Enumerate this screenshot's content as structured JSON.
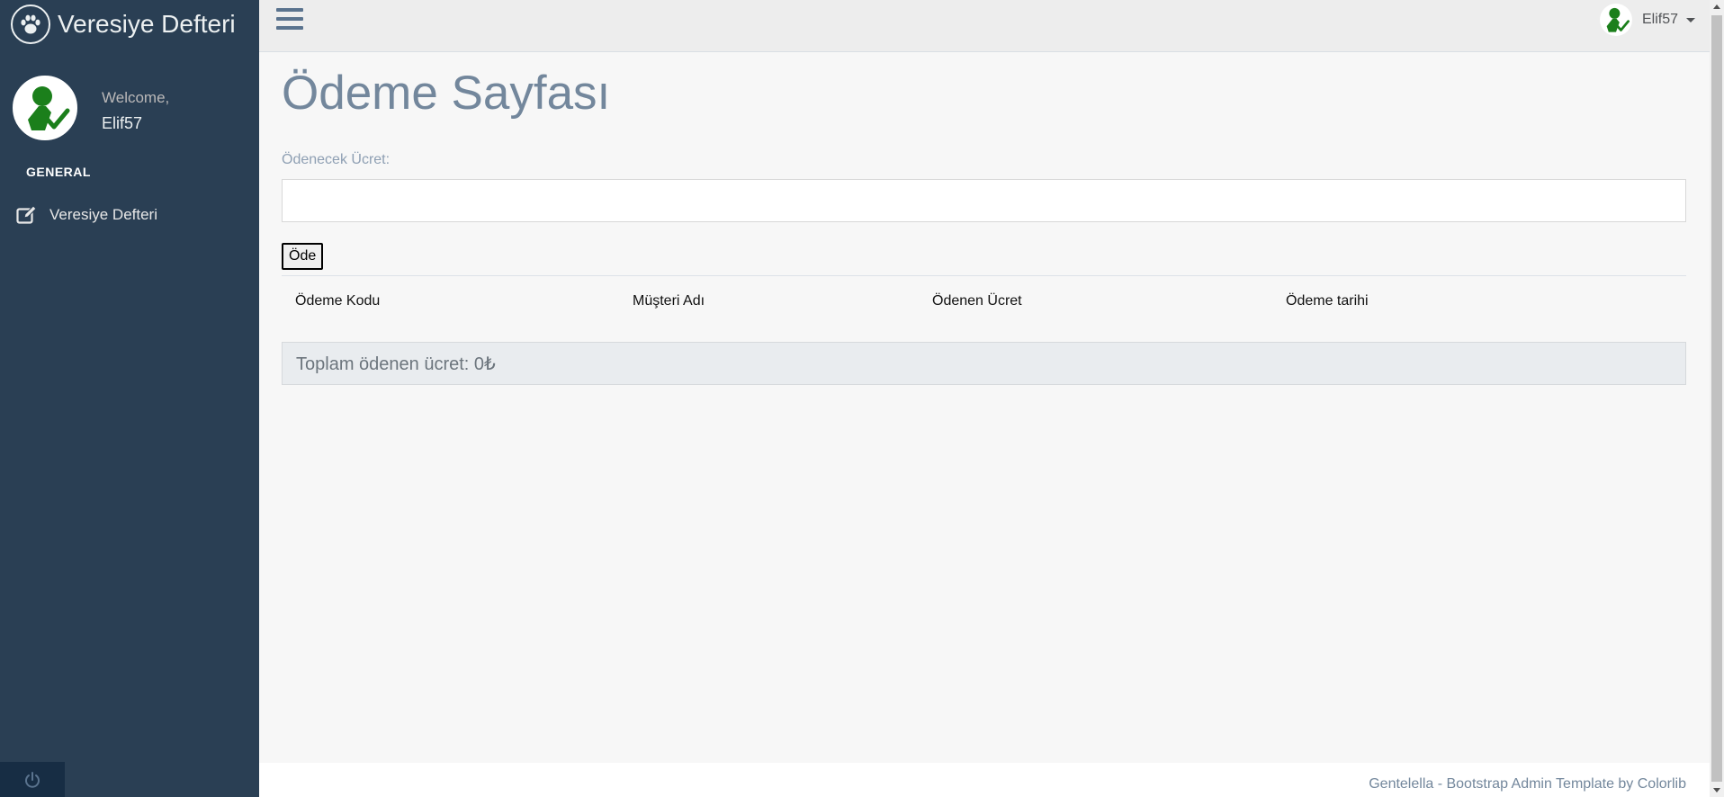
{
  "sidebar": {
    "brand_title": "Veresiye Defteri",
    "welcome": "Welcome,",
    "username": "Elif57",
    "section_title": "GENERAL",
    "nav_item_label": "Veresiye Defteri"
  },
  "topnav": {
    "username": "Elif57"
  },
  "main": {
    "page_title": "Ödeme Sayfası",
    "amount_label": "Ödenecek Ücret:",
    "amount_value": "",
    "pay_button": "Öde",
    "table_headers": [
      "Ödeme Kodu",
      "Müşteri Adı",
      "Ödenen Ücret",
      "Ödeme tarihi"
    ],
    "total_paid": "Toplam ödenen ücret: 0₺"
  },
  "footer": {
    "text": "Gentelella - Bootstrap Admin Template by Colorlib"
  },
  "colors": {
    "sidebar_bg": "#2A3F54",
    "topnav_bg": "#EDEDED",
    "content_bg": "#F7F7F7",
    "avatar_green": "#1B7F1B"
  },
  "icons": {
    "brand": "paw-icon",
    "nav": "edit-icon",
    "logout": "power-icon",
    "menu": "bars-icon"
  }
}
